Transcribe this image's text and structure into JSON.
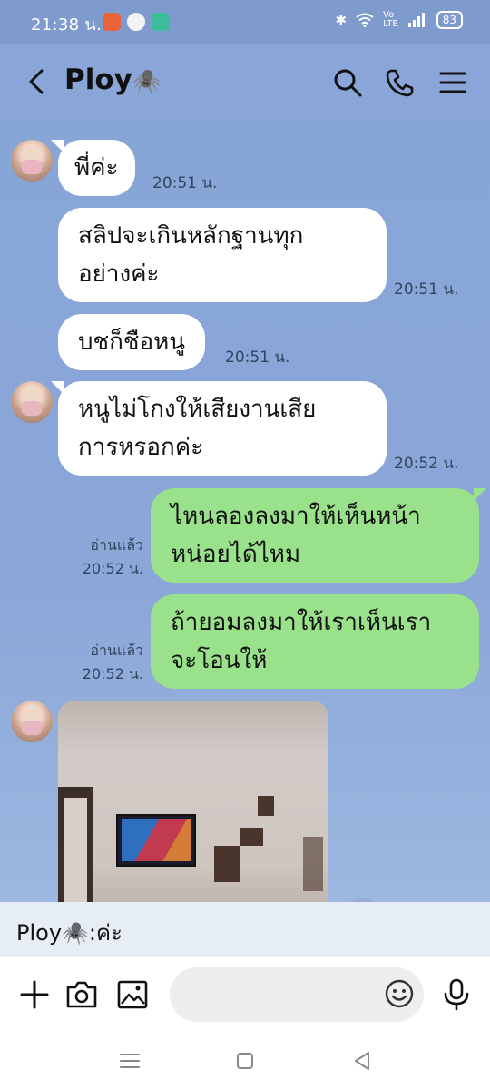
{
  "status_bar": {
    "time": "21:38 น.",
    "battery": "83"
  },
  "header": {
    "title": "Ploy",
    "title_emoji": "🕷️"
  },
  "messages": [
    {
      "side": "in",
      "text": "พี่ค่ะ",
      "time": "20:51 น."
    },
    {
      "side": "in",
      "text_lines": [
        "สลิปจะเกินหลักฐานทุก",
        "อย่างค่ะ"
      ],
      "time": "20:51 น."
    },
    {
      "side": "in",
      "text": "บชก็ชือหนู",
      "time": "20:51 น."
    },
    {
      "side": "in",
      "text_lines": [
        "หนูไม่โกงให้เสียงานเสีย",
        "การหรอกค่ะ"
      ],
      "time": "20:52 น."
    },
    {
      "side": "out",
      "text_lines": [
        "ไหนลองลงมาให้เห็นหน้า",
        "หน่อยได้ไหม"
      ],
      "read": "อ่านแล้ว",
      "time": "20:52 น."
    },
    {
      "side": "out",
      "text_lines": [
        "ถ้ายอมลงมาให้เราเห็นเรา",
        "จะโอนให้"
      ],
      "read": "อ่านแล้ว",
      "time": "20:52 น."
    }
  ],
  "notification": {
    "text": "Ploy🕷️:ค่ะ"
  },
  "input": {
    "placeholder": ""
  },
  "colors": {
    "chat_background": "#8aa6d8",
    "incoming_bubble": "#ffffff",
    "outgoing_bubble": "#99e18a"
  },
  "icons": [
    "back-icon",
    "search-icon",
    "phone-icon",
    "menu-icon",
    "share-icon",
    "plus-icon",
    "camera-icon",
    "image-icon",
    "emoji-icon",
    "mic-icon"
  ]
}
